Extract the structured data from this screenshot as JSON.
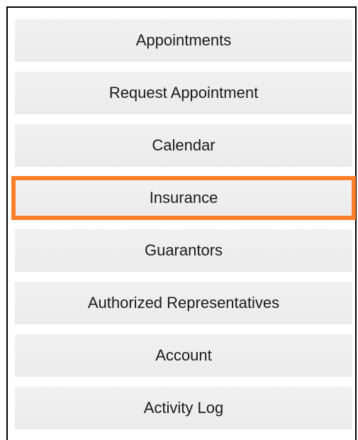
{
  "menu": {
    "highlight_color": "#fd7f2c",
    "highlighted_index": 3,
    "items": [
      {
        "label": "Appointments"
      },
      {
        "label": "Request Appointment"
      },
      {
        "label": "Calendar"
      },
      {
        "label": "Insurance"
      },
      {
        "label": "Guarantors"
      },
      {
        "label": "Authorized Representatives"
      },
      {
        "label": "Account"
      },
      {
        "label": "Activity Log"
      }
    ]
  }
}
